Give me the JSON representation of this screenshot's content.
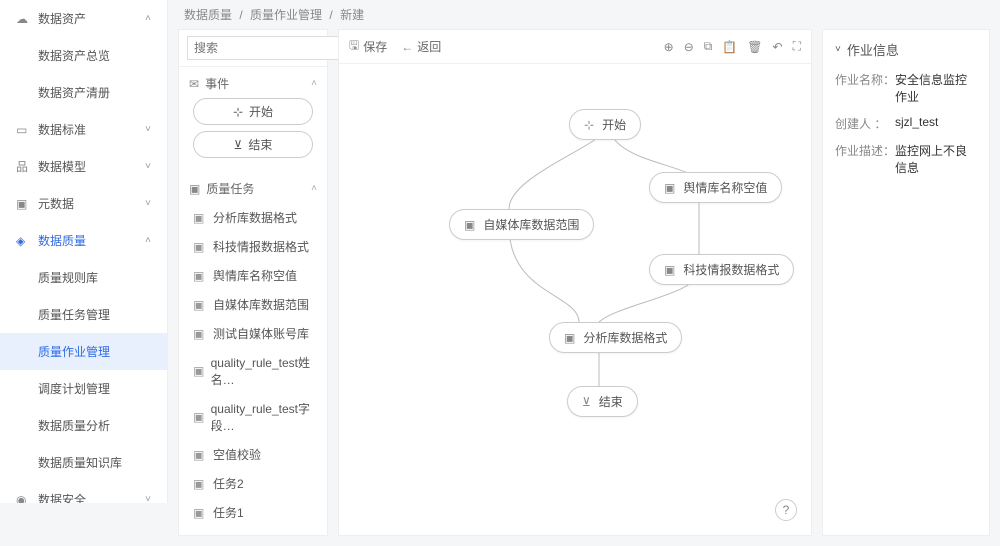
{
  "breadcrumb": [
    "数据质量",
    "质量作业管理",
    "新建"
  ],
  "search": {
    "placeholder": "搜索"
  },
  "sidebar": {
    "items": [
      {
        "label": "数据资产",
        "expanded": true
      },
      {
        "label": "数据标准",
        "expanded": false
      },
      {
        "label": "数据模型",
        "expanded": false
      },
      {
        "label": "元数据",
        "expanded": false
      },
      {
        "label": "数据质量",
        "expanded": true,
        "active": true
      },
      {
        "label": "数据安全",
        "expanded": false
      }
    ],
    "asset_children": [
      {
        "label": "数据资产总览"
      },
      {
        "label": "数据资产清册"
      }
    ],
    "quality_children": [
      {
        "label": "质量规则库"
      },
      {
        "label": "质量任务管理"
      },
      {
        "label": "质量作业管理",
        "active": true
      },
      {
        "label": "调度计划管理"
      },
      {
        "label": "数据质量分析"
      },
      {
        "label": "数据质量知识库"
      }
    ]
  },
  "palette": {
    "group_event": "事件",
    "start_label": "开始",
    "end_label": "结束",
    "group_task": "质量任务",
    "tasks": [
      "分析库数据格式",
      "科技情报数据格式",
      "舆情库名称空值",
      "自媒体库数据范围",
      "测试自媒体账号库",
      "quality_rule_test姓名…",
      "quality_rule_test字段…",
      "空值校验",
      "任务2",
      "任务1"
    ]
  },
  "toolbar": {
    "save": "保存",
    "back": "返回"
  },
  "nodes": {
    "start": "开始",
    "n1": "舆情库名称空值",
    "n2": "自媒体库数据范围",
    "n3": "科技情报数据格式",
    "n4": "分析库数据格式",
    "end": "结束"
  },
  "info": {
    "title": "作业信息",
    "rows": [
      {
        "k": "作业名称：",
        "v": "安全信息监控作业"
      },
      {
        "k": "创建人  ：",
        "v": "sjzl_test"
      },
      {
        "k": "作业描述：",
        "v": "监控网上不良信息"
      }
    ]
  }
}
